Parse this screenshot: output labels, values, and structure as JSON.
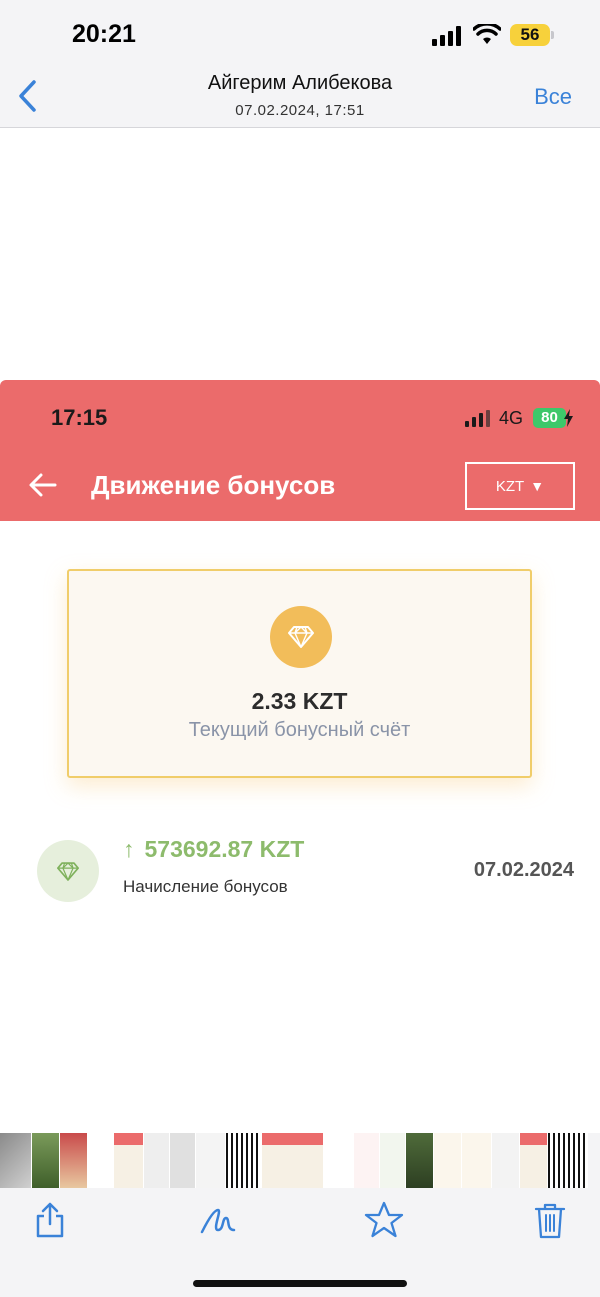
{
  "ios_status": {
    "time": "20:21",
    "battery": "56",
    "battery_color": "#f7d13b"
  },
  "nav": {
    "title": "Айгерим Алибекова",
    "subtitle": "07.02.2024, 17:51",
    "all_label": "Все",
    "accent_color": "#3a82d8",
    "back_icon": "chevron-left-icon"
  },
  "inner_screen": {
    "status": {
      "time": "17:15",
      "network": "4G",
      "battery": "80"
    },
    "header": {
      "title": "Движение бонусов",
      "currency": "KZT",
      "background": "#eb6b6b",
      "back_icon": "arrow-left-icon",
      "currency_caret": "▼"
    },
    "bonus_card": {
      "amount": "2.33 KZT",
      "caption": "Текущий бонусный счёт",
      "icon": "diamond-icon"
    },
    "transactions": [
      {
        "arrow": "↑",
        "amount": "573692.87 KZT",
        "description": "Начисление бонусов",
        "date": "07.02.2024",
        "icon": "diamond-icon",
        "amount_color": "#8dbb6c"
      }
    ]
  },
  "toolbar": {
    "icons": [
      "share-icon",
      "markup-icon",
      "favorite-star-icon",
      "trash-icon"
    ]
  }
}
